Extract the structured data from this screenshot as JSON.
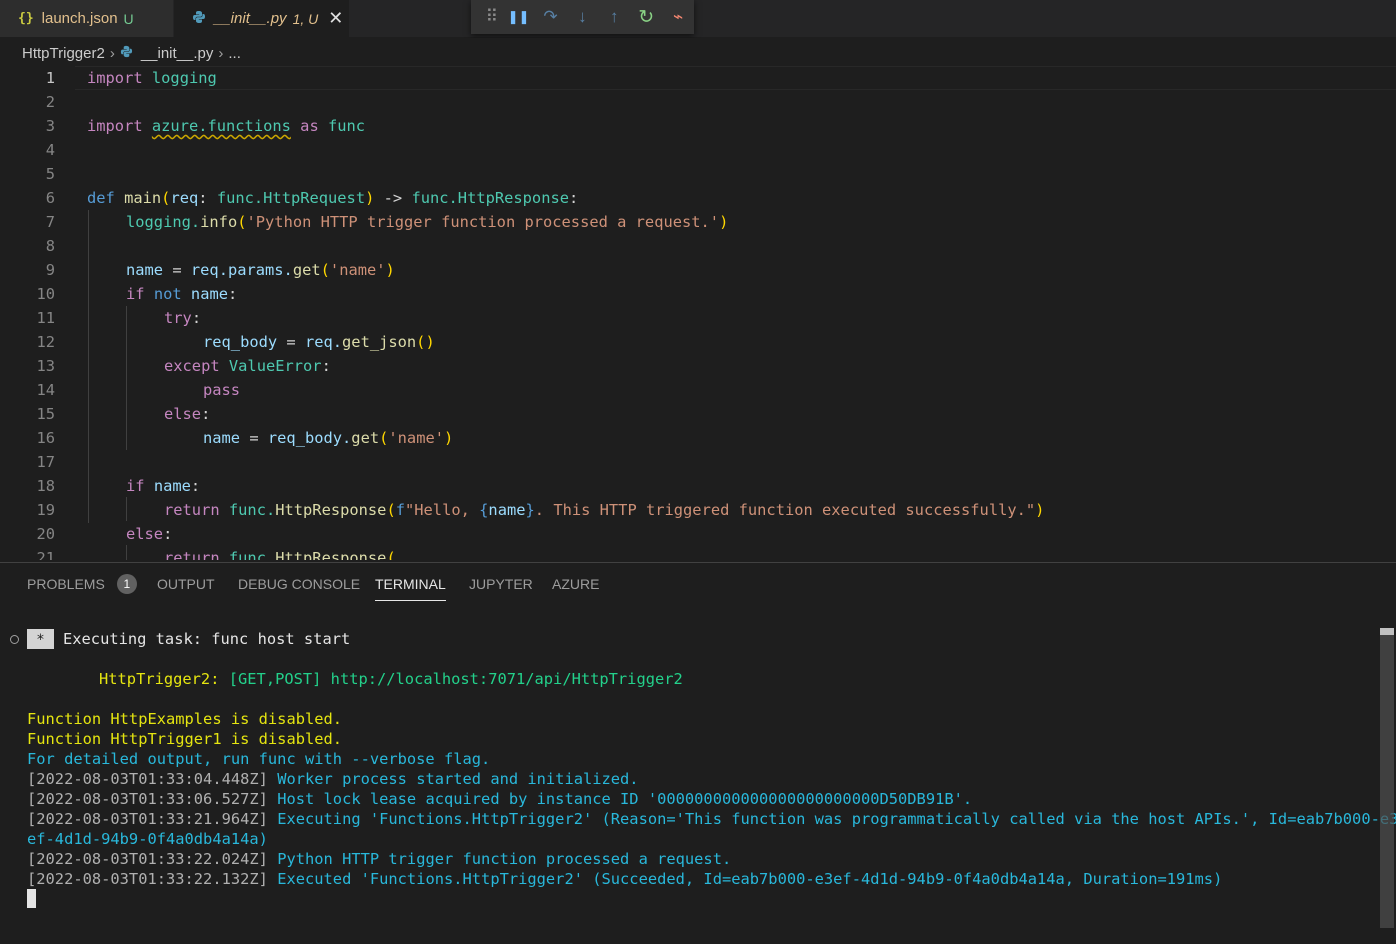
{
  "tabs": [
    {
      "icon": "{}",
      "name": "launch.json",
      "badge": "U"
    },
    {
      "icon": "py",
      "name": "__init__.py",
      "badge": "1, U",
      "close": "✕"
    }
  ],
  "debug_toolbar": {
    "grip": "⠿",
    "pause": "❚❚",
    "step_over": "↷",
    "step_into": "↓",
    "step_out": "↑",
    "restart": "↻",
    "disconnect": "⌁"
  },
  "breadcrumb": {
    "folder": "HttpTrigger2",
    "file": "__init__.py",
    "more": "...",
    "sep": "›"
  },
  "editor": {
    "line_numbers": [
      "1",
      "2",
      "3",
      "4",
      "5",
      "6",
      "7",
      "8",
      "9",
      "10",
      "11",
      "12",
      "13",
      "14",
      "15",
      "16",
      "17",
      "18",
      "19",
      "20",
      "21"
    ],
    "tok": {
      "import": "import",
      "logging": "logging",
      "azure_functions": "azure.functions",
      "as": "as",
      "func": "func",
      "def": "def",
      "main": "main",
      "paren_open": "(",
      "req": "req",
      "colon_sp": ": ",
      "func_dot": "func.",
      "HttpRequest": "HttpRequest",
      "paren_close": ")",
      "arrow": " -> ",
      "HttpResponse": "HttpResponse",
      "colon": ":",
      "logging_dot": "logging.",
      "info": "info",
      "str_processed": "'Python HTTP trigger function processed a request.'",
      "name": "name",
      "eq": " = ",
      "req_params": "req.params.",
      "get": "get",
      "str_name": "'name'",
      "if": "if",
      "not": "not",
      "try": "try",
      "req_body": "req_body",
      "req_dot": "req.",
      "get_json": "get_json",
      "parens": "()",
      "except": "except",
      "ValueError": "ValueError",
      "pass": "pass",
      "else": "else",
      "req_body_dot": "req_body.",
      "return": "return",
      "f": "f",
      "str_hello": "\"Hello, ",
      "brace_open": "{",
      "brace_close": "}",
      "str_rest": ". This HTTP triggered function executed successfully.\""
    }
  },
  "panel": {
    "tabs": [
      "PROBLEMS",
      "OUTPUT",
      "DEBUG CONSOLE",
      "TERMINAL",
      "JUPYTER",
      "AZURE"
    ],
    "problems_count": "1",
    "active_tab": "TERMINAL"
  },
  "terminal": {
    "task_star": "*",
    "task": "Executing task: func host start",
    "fn_name": "HttpTrigger2:",
    "fn_methods": "[GET,POST] http://localhost:7071/api/HttpTrigger2",
    "lines": [
      "Function HttpExamples is disabled.",
      "Function HttpTrigger1 is disabled.",
      "For detailed output, run func with --verbose flag."
    ],
    "log": [
      {
        "ts": "[2022-08-03T01:33:04.448Z]",
        "msg": "Worker process started and initialized."
      },
      {
        "ts": "[2022-08-03T01:33:06.527Z]",
        "msg": "Host lock lease acquired by instance ID '000000000000000000000000D50DB91B'."
      },
      {
        "ts": "[2022-08-03T01:33:21.964Z]",
        "msg": "Executing 'Functions.HttpTrigger2' (Reason='This function was programmatically called via the host APIs.', Id=eab7b000-e3",
        "cont": "ef-4d1d-94b9-0f4a0db4a14a)"
      },
      {
        "ts": "[2022-08-03T01:33:22.024Z]",
        "msg": "Python HTTP trigger function processed a request."
      },
      {
        "ts": "[2022-08-03T01:33:22.132Z]",
        "msg": "Executed 'Functions.HttpTrigger2' (Succeeded, Id=eab7b000-e3ef-4d1d-94b9-0f4a0db4a14a, Duration=191ms)"
      }
    ]
  },
  "colors": {
    "accent_green": "#23d18b",
    "accent_yellow": "#e5e510",
    "accent_blue": "#29b8db"
  }
}
